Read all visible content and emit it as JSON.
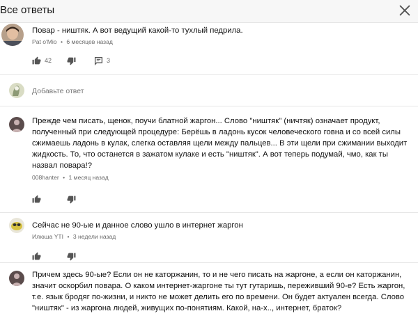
{
  "header": {
    "title": "Все ответы"
  },
  "top_comment": {
    "text": "Повар - ништяк. А вот ведущий какой-то тухлый педрила.",
    "author": "Pat o'Mio",
    "time": "6 месяцев назад",
    "likes": "42",
    "replies": "3"
  },
  "reply_box": {
    "placeholder": "Добавьте ответ"
  },
  "meta_separator": "•",
  "comments": [
    {
      "lines": [
        "Прежде чем писать, щенок, поучи блатной жаргон... Слово \"ништяк\" (ничтяк) означает продукт,",
        "полученный при следующей процедуре: Берёшь в ладонь кусок человеческого говна и со всей силы",
        "сжимаешь ладонь в кулак, слегка оставляя щели между пальцев... В эти щели при сжимании выходит",
        "жидкость. То, что останется в зажатом кулаке и есть \"ништяк\". А вот теперь подумай, чмо, как ты",
        "назвал повара!?"
      ],
      "author": "008hanter",
      "time": "1 месяц назад"
    },
    {
      "lines": [
        "Сейчас не 90-ые и данное слово ушло в интернет жаргон"
      ],
      "author": "Илюша YTI",
      "time": "3 недели назад"
    },
    {
      "lines": [
        "Причем здесь 90-ые? Если он не каторжанин, то и не чего писать на жаргоне, а если он каторжанин,",
        "значит оскорбил повара. О каком интернет-жаргоне ты тут гутаришь, переживший 90-е? Есть жаргон,",
        "т.е. язык бродяг по-жизни, и никто не может делить его по времени. Он будет актуален всегда. Слово",
        "\"ништяк\" - из жаргона людей, живущих по-понятиям. Какой, на-х.., интернет, браток?"
      ]
    }
  ]
}
